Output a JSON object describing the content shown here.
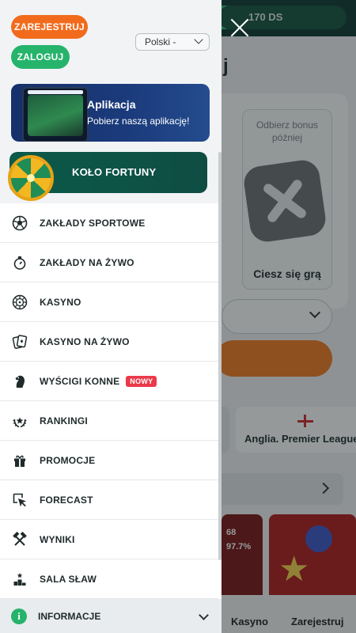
{
  "background": {
    "balance_pill": "170 DS",
    "heading_fragment": "j",
    "bonus_card": {
      "title": "Odbierz bonus później",
      "caption": "Ciesz się grą"
    },
    "league_chip": "Anglia. Premier League",
    "game_stats": {
      "players": "68",
      "rtp": "97.7%"
    },
    "bottom_nav": {
      "casino": "Kasyno",
      "register": "Zarejestruj"
    }
  },
  "drawer": {
    "register_button": "ZAREJESTRUJ",
    "login_button": "ZALOGUJ",
    "language": "Polski -",
    "app_banner": {
      "title": "Aplikacja",
      "subtitle": "Pobierz naszą aplikację!"
    },
    "wheel_banner": {
      "title": "KOŁO FORTUNY"
    },
    "menu_items": [
      {
        "label": "ZAKŁADY SPORTOWE",
        "icon": "soccer-ball-icon"
      },
      {
        "label": "ZAKŁADY NA ŻYWO",
        "icon": "stopwatch-icon"
      },
      {
        "label": "KASYNO",
        "icon": "roulette-icon"
      },
      {
        "label": "KASYNO NA ŻYWO",
        "icon": "cards-icon"
      },
      {
        "label": "WYŚCIGI KONNE",
        "icon": "horse-icon",
        "badge": "NOWY"
      },
      {
        "label": "RANKINGI",
        "icon": "laurel-star-icon"
      },
      {
        "label": "PROMOCJE",
        "icon": "gift-icon"
      },
      {
        "label": "FORECAST",
        "icon": "cursor-icon"
      },
      {
        "label": "WYNIKI",
        "icon": "crossed-hammers-icon"
      },
      {
        "label": "SALA SŁAW",
        "icon": "podium-icon"
      }
    ],
    "info": {
      "label": "INFORMACJE"
    }
  },
  "colors": {
    "accent_orange": "#f26b1d",
    "accent_green": "#26b36b",
    "badge_red": "#ea3a4a",
    "app_banner_blue": "#1b3b7c",
    "wheel_banner_green": "#0b5a4a"
  }
}
